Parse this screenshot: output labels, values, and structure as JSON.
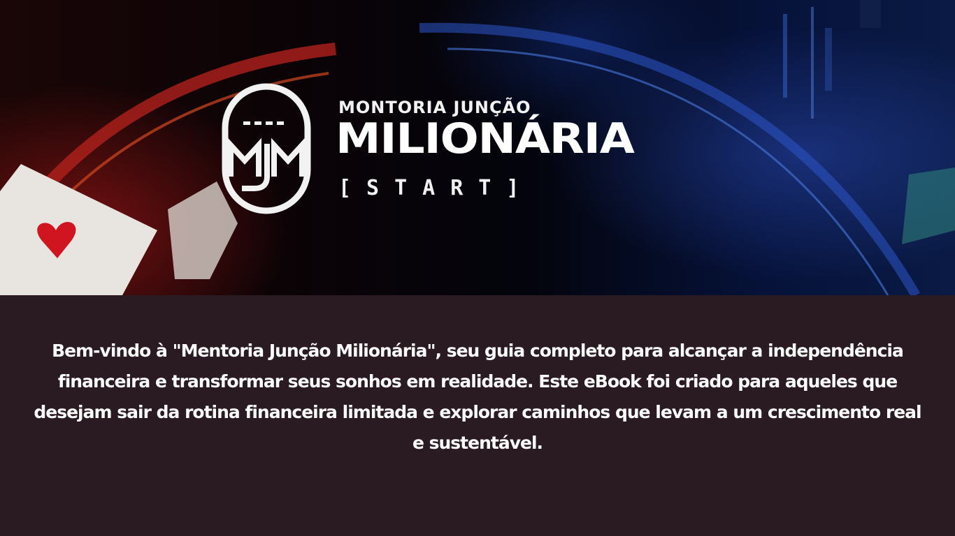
{
  "hero": {
    "subtitle": "MONTORIA JUNÇÃO",
    "title": "MILIONÁRIA",
    "tag": "[START]",
    "logo_icon": "mjm-monogram-icon"
  },
  "intro": {
    "text": "Bem-vindo à \"Mentoria Junção Milionária\", seu guia completo para alcançar a independência financeira e transformar seus sonhos em realidade. Este eBook foi criado para aqueles que desejam sair da rotina financeira limitada e explorar caminhos que levam a um crescimento real e sustentável."
  },
  "colors": {
    "background": "#2a1a22",
    "text": "#ffffff",
    "accent_red": "#c0141e",
    "accent_blue": "#1e3ca0"
  }
}
